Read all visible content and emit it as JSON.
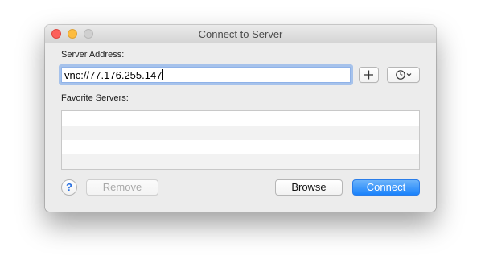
{
  "window": {
    "title": "Connect to Server",
    "controls": [
      "close",
      "minimize",
      "zoom"
    ]
  },
  "server_address": {
    "label": "Server Address:",
    "value": "vnc://77.176.255.147",
    "add_icon": "plus-icon",
    "recent_icon": "clock-icon"
  },
  "favorites": {
    "label": "Favorite Servers:",
    "items": []
  },
  "buttons": {
    "help_label": "?",
    "remove_label": "Remove",
    "browse_label": "Browse",
    "connect_label": "Connect"
  },
  "colors": {
    "accent": "#1a82fb",
    "close": "#fc605b",
    "minimize": "#fdbc40",
    "zoom_disabled": "#d0d0d0"
  }
}
